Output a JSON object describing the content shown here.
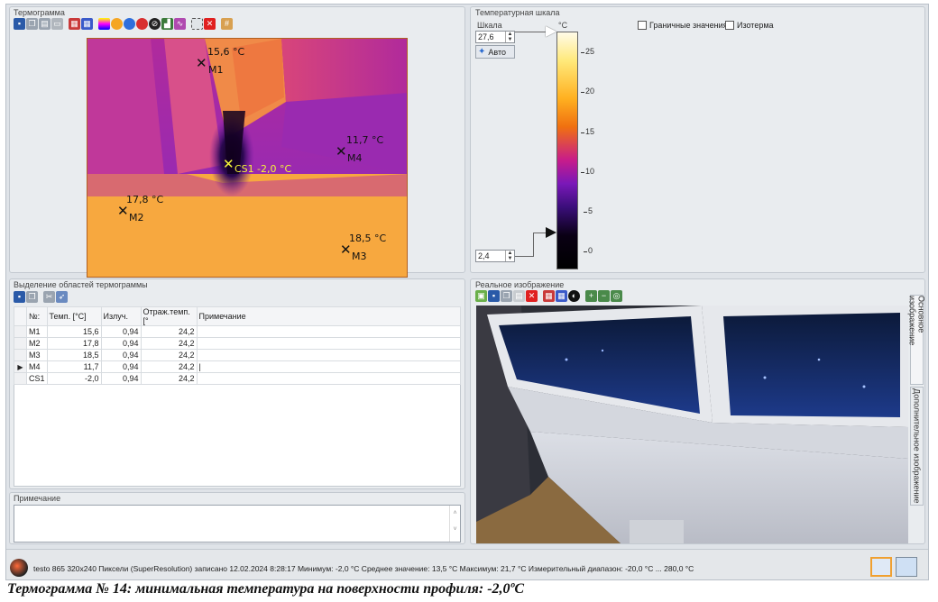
{
  "thermogram": {
    "title": "Термограмма",
    "markers": [
      {
        "label": "M1",
        "value": "15,6 °C",
        "color": "#111111"
      },
      {
        "label": "CS1",
        "value": "-2,0 °C",
        "color": "#f5f53a"
      },
      {
        "label": "M4",
        "value": "11,7 °C",
        "color": "#111111"
      },
      {
        "label": "M2",
        "value": "17,8 °C",
        "color": "#111111"
      },
      {
        "label": "M3",
        "value": "18,5 °C",
        "color": "#111111"
      }
    ],
    "toolbar_icons": [
      "save-icon",
      "copy-icon",
      "paste-icon",
      "window-icon",
      "palette-icon",
      "palette-alt-icon",
      "scale-icon",
      "sun-icon",
      "blue-circle-icon",
      "red-circle-icon",
      "prohibit-icon",
      "histogram-icon",
      "profile-icon",
      "select-icon",
      "delete-icon",
      "grid-icon"
    ]
  },
  "temp_scale": {
    "title": "Температурная шкала",
    "scale_label": "Шкала",
    "unit": "°C",
    "max_value": "27,6",
    "min_value": "2,4",
    "auto_button": "Авто",
    "ticks": [
      "25",
      "20",
      "15",
      "10",
      "5",
      "0"
    ],
    "limit_values_label": "Граничные значения",
    "isotherm_label": "Изотерма"
  },
  "regions": {
    "title": "Выделение областей термограммы",
    "columns": [
      "№:",
      "Темп. [°C]",
      "Излуч.",
      "Отраж.темп. [°",
      "Примечание"
    ],
    "rows": [
      {
        "id": "M1",
        "temp": "15,6",
        "emis": "0,94",
        "refl": "24,2",
        "note": ""
      },
      {
        "id": "M2",
        "temp": "17,8",
        "emis": "0,94",
        "refl": "24,2",
        "note": ""
      },
      {
        "id": "M3",
        "temp": "18,5",
        "emis": "0,94",
        "refl": "24,2",
        "note": ""
      },
      {
        "id": "M4",
        "temp": "11,7",
        "emis": "0,94",
        "refl": "24,2",
        "note": "|"
      },
      {
        "id": "CS1",
        "temp": "-2,0",
        "emis": "0,94",
        "refl": "24,2",
        "note": ""
      }
    ],
    "selected_row_marker": "▶"
  },
  "note_panel": {
    "title": "Примечание",
    "value": ""
  },
  "real_image": {
    "title": "Реальное изображение",
    "tab_main": "Основное изображение",
    "tab_extra": "Дополнительное изображение"
  },
  "status": {
    "text": "testo 865 320x240 Пиксели (SuperResolution) записано 12.02.2024 8:28:17  Минимум: -2,0 °C  Среднее значение: 13,5 °C  Максимум: 21,7 °C  Измерительный диапазон: -20,0 °C ... 280,0 °C"
  },
  "caption": "Термограмма № 14: минимальная температура на поверхности профиля: -2,0ºС"
}
